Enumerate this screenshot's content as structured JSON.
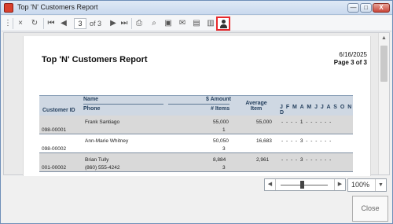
{
  "window": {
    "title": "Top 'N' Customers Report",
    "controls": [
      "—",
      "□",
      "X"
    ]
  },
  "toolbar": {
    "page_value": "3",
    "page_total_text": "of 3",
    "icons": [
      "dots-icon",
      "close-icon",
      "refresh-icon",
      "first-page-icon",
      "prev-page-icon",
      "next-page-icon",
      "last-page-icon",
      "print-icon",
      "search-icon",
      "page-setup-icon",
      "email-icon",
      "export-icon",
      "excel-icon",
      "user-icon"
    ]
  },
  "report": {
    "title": "Top 'N' Customers Report",
    "date": "6/16/2025",
    "page_label": "Page 3 of 3",
    "headers": {
      "customer_id": "Customer ID",
      "name": "Name",
      "phone": "Phone",
      "amount": "$ Amount",
      "items": "# Items",
      "average_item": "Average Item",
      "months": "J F M A M J J A S O N D"
    },
    "rows": [
      {
        "name": "Frank Santiago",
        "amount": "55,000",
        "average": "55,000",
        "months": "- - - - 1 - - - - - -",
        "customer_id": "098-00001",
        "items": "1",
        "shaded": true
      },
      {
        "name": "Ann-Marie Whitney",
        "amount": "50,050",
        "average": "16,683",
        "months": "- - - - 3 - - - - - -",
        "customer_id": "098-00002",
        "items": "3",
        "shaded": false
      },
      {
        "name": "Brian Tully",
        "phone": "(860) 555-4242",
        "amount": "8,884",
        "average": "2,961",
        "months": "- - - - 3 - - - - - -",
        "customer_id": "001-00002",
        "items": "3",
        "shaded": true
      }
    ]
  },
  "footer": {
    "zoom_value": "100%",
    "close_label": "Close"
  }
}
